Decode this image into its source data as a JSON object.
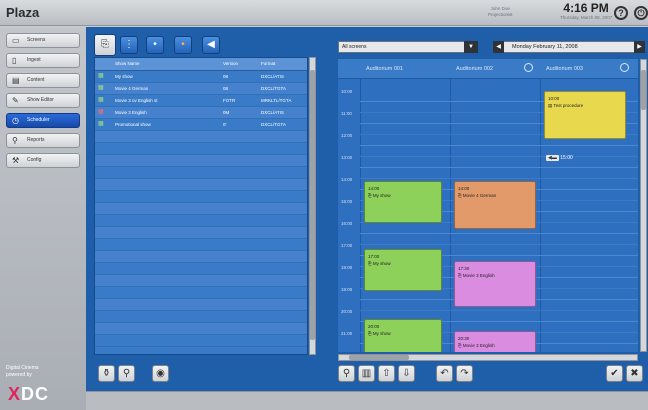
{
  "app": {
    "title": "Plaza",
    "user_line1": "John Doe",
    "user_line2": "Projectionist",
    "time": "4:16 PM",
    "date": "Thursday, March 08, 2007"
  },
  "sidebar": {
    "items": [
      {
        "label": "Screens",
        "icon": "screens-icon"
      },
      {
        "label": "Ingest",
        "icon": "ingest-icon"
      },
      {
        "label": "Content",
        "icon": "content-icon"
      },
      {
        "label": "Show Editor",
        "icon": "show-editor-icon"
      },
      {
        "label": "Scheduler",
        "icon": "clock-icon",
        "active": true
      },
      {
        "label": "Reports",
        "icon": "search-icon"
      },
      {
        "label": "Config",
        "icon": "wrench-icon"
      }
    ],
    "footer_line1": "Digital Cinema",
    "footer_line2": "powered by",
    "logo": "XDC"
  },
  "shows": {
    "columns": [
      "Show Name",
      "Version",
      "Format"
    ],
    "rows": [
      {
        "name": "My show",
        "version": "08",
        "format": "DXCL/ATIS",
        "icon": "show-icon"
      },
      {
        "name": "Movie 4 German",
        "version": "08",
        "format": "DXCL/TGTA",
        "icon": "show-icon"
      },
      {
        "name": "Movie 3 ov English st",
        "version": "FOTR",
        "format": "MRKLTL/TGTA",
        "icon": "show-icon"
      },
      {
        "name": "Movie 3 English",
        "version": "0M",
        "format": "DXCL/ATIS",
        "icon": "show-red-icon"
      },
      {
        "name": "Promotional show",
        "version": "0'",
        "format": "DXCL/TGTA",
        "icon": "show-icon"
      }
    ]
  },
  "schedule": {
    "screen_filter": "All screens",
    "date": "Monday February 11, 2008",
    "auditoriums": [
      "Auditorium 001",
      "Auditorium 002",
      "Auditorium 003"
    ],
    "times": [
      "10:00",
      "11:00",
      "12:00",
      "13:00",
      "14:00",
      "15:00",
      "16:00",
      "17:00",
      "18:00",
      "19:00",
      "20:00",
      "21:00"
    ],
    "events": [
      {
        "time": "10:00",
        "title": "Test procedure",
        "color": "#e8d84e",
        "auditorium": "Auditorium 003"
      },
      {
        "time": "14:00",
        "title": "My show",
        "color": "#8dd05a",
        "auditorium": "Auditorium 001"
      },
      {
        "time": "14:00",
        "title": "Movie 4 German",
        "color": "#e39a6a",
        "auditorium": "Auditorium 002"
      },
      {
        "time": "17:00",
        "title": "My show",
        "color": "#8dd05a",
        "auditorium": "Auditorium 001"
      },
      {
        "time": "17:30",
        "title": "Movie 3 English",
        "color": "#d98ce0",
        "auditorium": "Auditorium 002"
      },
      {
        "time": "20:00",
        "title": "My show",
        "color": "#8dd05a",
        "auditorium": "Auditorium 001"
      },
      {
        "time": "20:30",
        "title": "Movie 3 English",
        "color": "#d98ce0",
        "auditorium": "Auditorium 002"
      }
    ],
    "marker_time": "15:00"
  }
}
